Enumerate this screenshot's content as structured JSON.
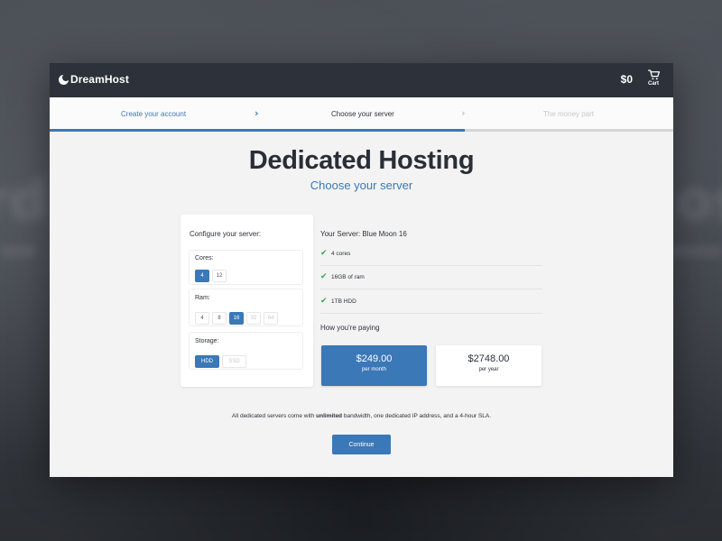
{
  "app": {
    "brand": "DreamHost"
  },
  "header": {
    "total": "$0",
    "cart_label": "Cart"
  },
  "steps": [
    {
      "label": "Create your account",
      "state": "completed"
    },
    {
      "label": "Choose your server",
      "state": "current"
    },
    {
      "label": "The money part",
      "state": "upcoming"
    }
  ],
  "progress": {
    "completed_fraction": 0.666
  },
  "page": {
    "title": "Dedicated Hosting",
    "subtitle": "Choose your server"
  },
  "config": {
    "title": "Configure your server:",
    "cores": {
      "label": "Cores:",
      "options": [
        "4",
        "12"
      ],
      "selected": "4"
    },
    "ram": {
      "label": "Ram:",
      "options": [
        "4",
        "8",
        "16",
        "32",
        "64"
      ],
      "selected": "16",
      "disabled": [
        "32",
        "64"
      ]
    },
    "storage": {
      "label": "Storage:",
      "options": [
        "HDD",
        "SSD"
      ],
      "selected": "HDD",
      "disabled": [
        "SSD"
      ]
    }
  },
  "summary": {
    "server_heading": "Your Server: Blue Moon 16",
    "specs": [
      "4 cores",
      "16GB of ram",
      "1TB HDD"
    ],
    "paying_heading": "How you're paying"
  },
  "plans": {
    "monthly": {
      "price": "$249.00",
      "period": "per month",
      "selected": true
    },
    "yearly": {
      "price": "$2748.00",
      "period": "per year",
      "selected": false
    }
  },
  "footnote": {
    "before": "All dedicated servers come with ",
    "bold": "unlimited",
    "after": " bandwidth, one dedicated IP address, and a 4-hour SLA."
  },
  "actions": {
    "continue_label": "Continue"
  },
  "colors": {
    "accent": "#3a78b8",
    "header_bg": "#2d3139",
    "check": "#3aa64a"
  },
  "icons": {
    "cart": "cart-icon",
    "check": "check-icon",
    "chevron": "chevron-right-icon",
    "logo": "dreamhost-logo-icon"
  }
}
